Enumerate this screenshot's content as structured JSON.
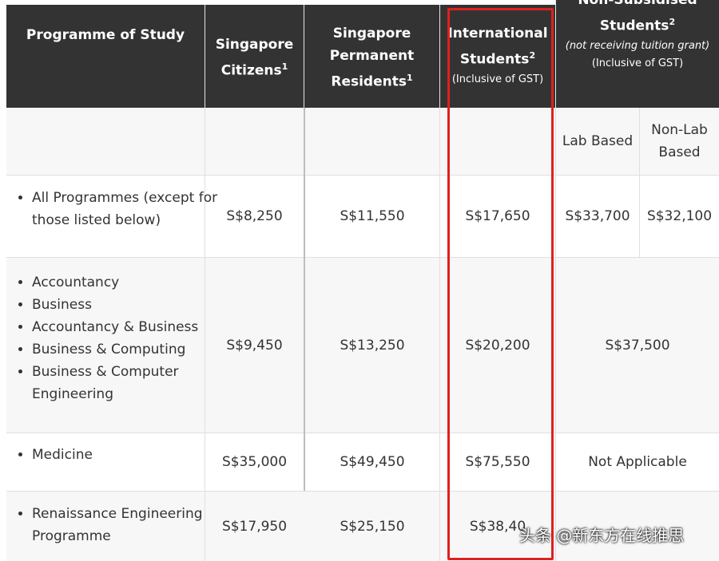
{
  "header": {
    "programme": "Programme of Study",
    "citizens": {
      "line1": "Singapore",
      "line2": "Citizens",
      "sup": "1"
    },
    "pr": {
      "line1": "Singapore",
      "line2": "Permanent",
      "line3": "Residents",
      "sup": "1"
    },
    "intl": {
      "line1": "International",
      "line2": "Students",
      "sup": "2",
      "note": "(Inclusive of GST)"
    },
    "nonsub": {
      "line1": "Non-Subsidised",
      "line2": "Students",
      "sup": "2",
      "note_italic": "(not receiving tuition grant)",
      "note": "(Inclusive of GST)"
    },
    "lab": "Lab Based",
    "nonlab_line1": "Non-Lab",
    "nonlab_line2": "Based"
  },
  "rows": [
    {
      "programmes": [
        "All Programmes (except for those listed below)"
      ],
      "citizens": "S$8,250",
      "pr": "S$11,550",
      "intl": "S$17,650",
      "lab": "S$33,700",
      "nonlab": "S$32,100"
    },
    {
      "programmes": [
        "Accountancy",
        "Business",
        "Accountancy & Business",
        "Business & Computing",
        "Business & Computer Engineering"
      ],
      "citizens": "S$9,450",
      "pr": "S$13,250",
      "intl": "S$20,200",
      "nonsub": "S$37,500"
    },
    {
      "programmes": [
        "Medicine"
      ],
      "citizens": "S$35,000",
      "pr": "S$49,450",
      "intl": "S$75,550",
      "nonsub": "Not Applicable"
    },
    {
      "programmes": [
        "Renaissance Engineering Programme"
      ],
      "citizens": "S$17,950",
      "pr": "S$25,150",
      "intl": "S$38,40"
    }
  ],
  "watermark": "头条 @新东方在线推思",
  "colors": {
    "header_bg": "#333333",
    "highlight": "#e02020",
    "text": "#333333"
  }
}
